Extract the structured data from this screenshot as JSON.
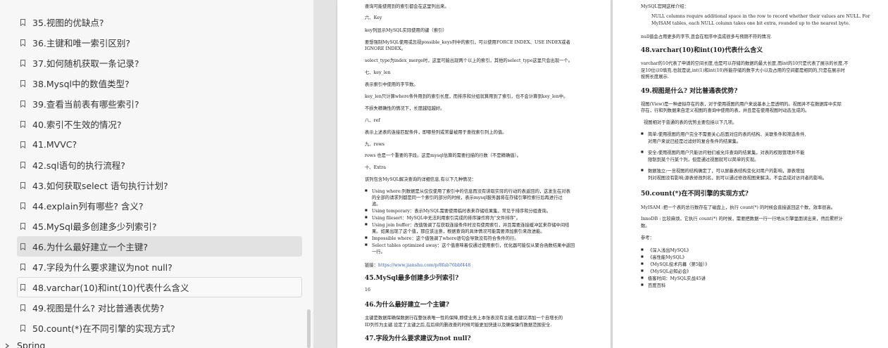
{
  "sidebar": {
    "bookmarks": [
      {
        "label": "35.视图的优缺点?"
      },
      {
        "label": "36.主键和唯一索引区别?"
      },
      {
        "label": "37.如何随机获取一条记录?"
      },
      {
        "label": "38.Mysql中的数值类型?"
      },
      {
        "label": "39.查看当前表有哪些索引?"
      },
      {
        "label": "40.索引不生效的情况?"
      },
      {
        "label": "41.MVVC?"
      },
      {
        "label": "42.sql语句的执行流程?"
      },
      {
        "label": "43.如何获取select 语句执行计划?"
      },
      {
        "label": "44.explain列有哪些? 含义?"
      },
      {
        "label": "45.MySql最多创建多少列索引?"
      },
      {
        "label": "46.为什么最好建立一个主键?"
      },
      {
        "label": "47.字段为什么要求建议为not null?"
      },
      {
        "label": "48.varchar(10)和int(10)代表什么含义"
      },
      {
        "label": "49.视图是什么? 对比普通表优势?"
      },
      {
        "label": "50.count(*)在不同引擎的实现方式?"
      }
    ],
    "next_section": "Spring"
  },
  "page_left": {
    "l01": "查询可能使用到的索引都会在这里列出来。",
    "l02": "六、Key",
    "l03": "key列显示MySQL实际使用的键（索引）",
    "l04": "要想强制MySQL使用或忽视possible_keys列中的索引，可以使用FORCE INDEX、USE INDEX或者",
    "l05": "IGNORE INDEX。",
    "l06": "select_type为index_merge时，这里可能出现两个以上的索引，其他的select_type这里只会出现一个。",
    "l07": "七、key_len",
    "l08": "表示索引中使用的字节数。",
    "l09": "key_len只计算where条件用到的索引长度，而排序和分组就算用到了索引，也不会计算到key_len中。",
    "l10": "不损失精确性的情况下，长度越短越好。",
    "l11": "八、ref",
    "l12": "表示上述表的连接匹配条件，即哪些列或常量被用于查找索引列上的值。",
    "l13": "九、rows",
    "l14": "rows 也是一个重要的字段。这是mysql估算的需要扫描的行数（不是精确值）。",
    "l15": "十、Extra",
    "l16": "该列包含MySQL解决查询的详细信息,有以下几种情况：",
    "b1a": "Using where:列数据是从仅仅使用了索引中的信息而没有读取实际的行动的表返回的，这发生在对表",
    "b1b": "的全部的请求列都是同一个索引的部分的时候，表示mysql服务器将在存储引擎检索行后再进行过",
    "b1c": "滤。",
    "b2": "Using temporary：表示MySQL需要使用临时表来存储结果集，常见于排序和分组查询。",
    "b3": "Using filesort：MySQL中无法利用索引完成的排序操作称为\"文件排序\"。",
    "b4a": "Using join buffer：改值强调了在获取连接条件时没有使用索引，并且需要连接缓冲区来存储中间结",
    "b4b": "果。如果出现了这个值，那应该注意，根据查询的具体情况可能需要添加索引来改进能。",
    "b5": "Impossible where：这个值强调了where语句会导致没有符合条件的行。",
    "b6a": "Select tables optimized away：这个值意味着仅通过使用索引，优化器可能仅从聚合函数结果中返回",
    "b6b": "一行。",
    "link_label": "链接：",
    "link_url": "https://www.jianshu.com/p/8fab76bbf448",
    "h45": "45.MySql最多创建多少列索引?",
    "a45": "16",
    "h46": "46.为什么最好建立一个主键?",
    "a46a": "主键是数据库确保数据行在整张表唯一性的保障,即使业务上本张表没有主键,也建议添加一个自增长的",
    "a46b": "ID列作为主键.设定了主键之后,在后续的删改查的时候可能更加快速以及确保操作数据范围安全.",
    "h47": "47.字段为什么要求建议为not null?"
  },
  "page_right": {
    "r01": "MySQL官网这样介绍：",
    "r02": "NULL columns require additional space in the row to record whether their values are NULL. For",
    "r03": "MyISAM tables, each NULL column takes one bit extra, rounded up to the nearest byte.",
    "r04": "null值会占用更多的字节,且会在程序中造成很多与预期不符的情况.",
    "h48": "48.varchar(10)和int(10)代表什么含义",
    "r05": "varchar的10代表了申请的空间长度,也是可以存储的数据的最大长度,而int的10只是代表了展示的长度,不",
    "r06": "足10位以0填充.也就是说,int(1)和int(10)所能存储的数字大小以及占用的空间都是相同的,只是在展示时",
    "r07": "按照长度展示.",
    "h49": "49.视图是什么? 对比普通表优势?",
    "r08": "视图(View)是一种虚拟存在的表，对于使用视图的用户来说基本上是透明的。视图并不在数据库中实际",
    "r09": "存在，行和列数据来自定义视图的查询中使用的表，并且是在使用视图时动态生成的。",
    "r10": "视图相对于普通的表的优势主要包括以下几项。",
    "c1a": "简单:使用视图的用户完全不需要关心后面对应的表的结构、关联条件和筛选条件,",
    "c1b": "对用户来说已经是过滤好的复合条件的结果集。",
    "c2a": "安全:使用视图的用户只能访问他们被允许查询的结果集，对表的权限管理并不能",
    "c2b": "限制到某个行某个列，但是通过视图就可以简单的实现。",
    "c3a": "数据独立:一旦视图的结构确定了，可以屏蔽表结构变化对用户的影响，源表增加",
    "c3b": "列对视图没有影响;源表修改列名，则可以通过修改视图来解决，不会造成对访问者的影响。",
    "h50": "50.count(*)在不同引擎的实现方式?",
    "r11": "MyISAM :把一个表的总行数存在了磁盘上，执行 count(*) 的时候会直接返回这个数，效率很高。",
    "r12": "InnoDB : 比较麻烦，它执行 count(*) 的时候，需要把数据一行一行地从引擎里面读出来，然后累积计",
    "r13": "数。",
    "ref_label": "参考：",
    "refs": [
      "《深入浅出MySQL》",
      "《高性能MySQL》",
      "《MySQL技术内幕（第5版）》",
      "《MySQL必知必会》",
      "极客时间：MySQL实战45讲",
      "百度百科"
    ]
  }
}
